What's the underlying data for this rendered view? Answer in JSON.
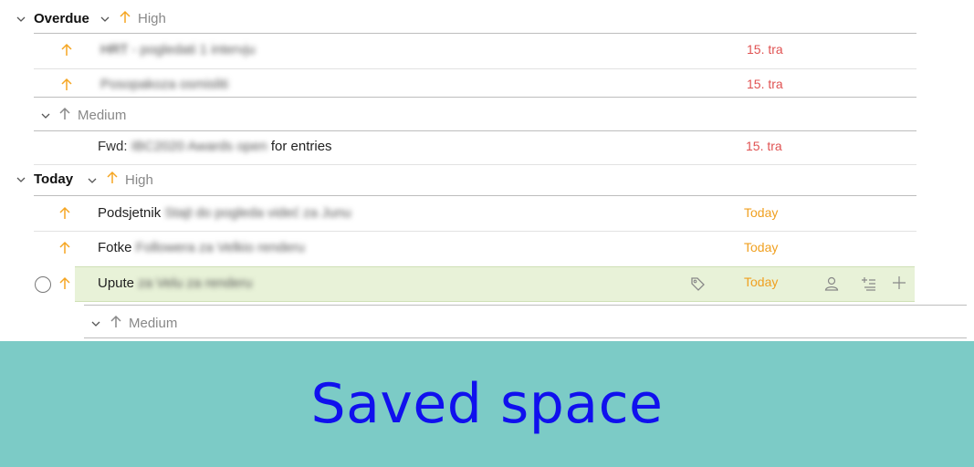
{
  "overdue": {
    "label": "Overdue",
    "priority_high": "High",
    "priority_medium": "Medium",
    "tasks_high": [
      {
        "prefix": "HRT",
        "text": " - pogledati 1 intervju",
        "date": "15. tra"
      },
      {
        "prefix": "",
        "text": "Posopakoza osmisliti",
        "date": "15. tra"
      }
    ],
    "tasks_medium": [
      {
        "prefix": "Fwd: ",
        "text": "IBC2020 Awards open",
        "suffix": " for entries",
        "date": "15. tra"
      }
    ]
  },
  "today": {
    "label": "Today",
    "priority_high": "High",
    "priority_medium": "Medium",
    "tasks_high": [
      {
        "prefix": "Podsjetnik",
        "text": " Stajt do pogleda videć za Junu",
        "date": "Today"
      },
      {
        "prefix": "Fotke",
        "text": " Followera za Velkio renderu",
        "date": "Today"
      },
      {
        "prefix": "Upute",
        "text": " za Velu za renderu",
        "date": "Today"
      }
    ]
  },
  "banner": {
    "text": "Saved space"
  },
  "colors": {
    "priority_high": "#f5a623",
    "overdue_date": "#e05252",
    "today_date": "#f0a020",
    "selected_row": "#e8f2d8",
    "banner_bg": "#7ccbc6",
    "banner_text": "#1010ee"
  },
  "icons": {
    "collapse": "chevron-down-icon",
    "priority": "arrow-up-icon",
    "tag": "tag-icon",
    "assign": "person-icon",
    "subtask": "add-subtask-icon",
    "add": "plus-icon",
    "complete": "circle-checkbox-icon"
  }
}
